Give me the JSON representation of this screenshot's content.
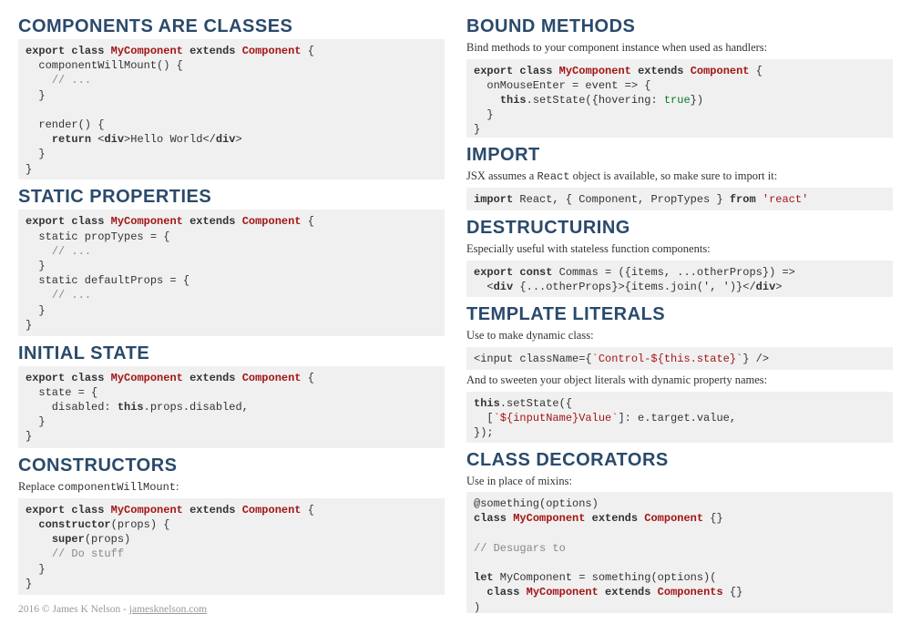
{
  "left": {
    "s1": {
      "title": "Components are Classes",
      "code_tokens": [
        {
          "t": "kw",
          "v": "export"
        },
        {
          "t": "sp",
          "v": " "
        },
        {
          "t": "kw",
          "v": "class"
        },
        {
          "t": "sp",
          "v": " "
        },
        {
          "t": "cls",
          "v": "MyComponent"
        },
        {
          "t": "sp",
          "v": " "
        },
        {
          "t": "kw",
          "v": "extends"
        },
        {
          "t": "sp",
          "v": " "
        },
        {
          "t": "ext",
          "v": "Component"
        },
        {
          "t": "txt",
          "v": " {"
        },
        {
          "t": "nl"
        },
        {
          "t": "txt",
          "v": "  componentWillMount() {"
        },
        {
          "t": "nl"
        },
        {
          "t": "txt",
          "v": "    "
        },
        {
          "t": "com",
          "v": "// ..."
        },
        {
          "t": "nl"
        },
        {
          "t": "txt",
          "v": "  }"
        },
        {
          "t": "nl"
        },
        {
          "t": "nl"
        },
        {
          "t": "txt",
          "v": "  render() {"
        },
        {
          "t": "nl"
        },
        {
          "t": "txt",
          "v": "    "
        },
        {
          "t": "kw",
          "v": "return"
        },
        {
          "t": "txt",
          "v": " <"
        },
        {
          "t": "kw",
          "v": "div"
        },
        {
          "t": "txt",
          "v": ">Hello World</"
        },
        {
          "t": "kw",
          "v": "div"
        },
        {
          "t": "txt",
          "v": ">"
        },
        {
          "t": "nl"
        },
        {
          "t": "txt",
          "v": "  }"
        },
        {
          "t": "nl"
        },
        {
          "t": "txt",
          "v": "}"
        }
      ]
    },
    "s2": {
      "title": "Static Properties",
      "code_tokens": [
        {
          "t": "kw",
          "v": "export"
        },
        {
          "t": "sp",
          "v": " "
        },
        {
          "t": "kw",
          "v": "class"
        },
        {
          "t": "sp",
          "v": " "
        },
        {
          "t": "cls",
          "v": "MyComponent"
        },
        {
          "t": "sp",
          "v": " "
        },
        {
          "t": "kw",
          "v": "extends"
        },
        {
          "t": "sp",
          "v": " "
        },
        {
          "t": "ext",
          "v": "Component"
        },
        {
          "t": "txt",
          "v": " {"
        },
        {
          "t": "nl"
        },
        {
          "t": "txt",
          "v": "  static propTypes = {"
        },
        {
          "t": "nl"
        },
        {
          "t": "txt",
          "v": "    "
        },
        {
          "t": "com",
          "v": "// ..."
        },
        {
          "t": "nl"
        },
        {
          "t": "txt",
          "v": "  }"
        },
        {
          "t": "nl"
        },
        {
          "t": "txt",
          "v": "  static defaultProps = {"
        },
        {
          "t": "nl"
        },
        {
          "t": "txt",
          "v": "    "
        },
        {
          "t": "com",
          "v": "// ..."
        },
        {
          "t": "nl"
        },
        {
          "t": "txt",
          "v": "  }"
        },
        {
          "t": "nl"
        },
        {
          "t": "txt",
          "v": "}"
        }
      ]
    },
    "s3": {
      "title": "Initial State",
      "code_tokens": [
        {
          "t": "kw",
          "v": "export"
        },
        {
          "t": "sp",
          "v": " "
        },
        {
          "t": "kw",
          "v": "class"
        },
        {
          "t": "sp",
          "v": " "
        },
        {
          "t": "cls",
          "v": "MyComponent"
        },
        {
          "t": "sp",
          "v": " "
        },
        {
          "t": "kw",
          "v": "extends"
        },
        {
          "t": "sp",
          "v": " "
        },
        {
          "t": "ext",
          "v": "Component"
        },
        {
          "t": "txt",
          "v": " {"
        },
        {
          "t": "nl"
        },
        {
          "t": "txt",
          "v": "  state = {"
        },
        {
          "t": "nl"
        },
        {
          "t": "txt",
          "v": "    disabled: "
        },
        {
          "t": "kw",
          "v": "this"
        },
        {
          "t": "txt",
          "v": ".props.disabled,"
        },
        {
          "t": "nl"
        },
        {
          "t": "txt",
          "v": "  }"
        },
        {
          "t": "nl"
        },
        {
          "t": "txt",
          "v": "}"
        }
      ]
    },
    "s4": {
      "title": "Constructors",
      "desc_pre": "Replace ",
      "desc_code": "componentWillMount",
      "desc_post": ":",
      "code_tokens": [
        {
          "t": "kw",
          "v": "export"
        },
        {
          "t": "sp",
          "v": " "
        },
        {
          "t": "kw",
          "v": "class"
        },
        {
          "t": "sp",
          "v": " "
        },
        {
          "t": "cls",
          "v": "MyComponent"
        },
        {
          "t": "sp",
          "v": " "
        },
        {
          "t": "kw",
          "v": "extends"
        },
        {
          "t": "sp",
          "v": " "
        },
        {
          "t": "ext",
          "v": "Component"
        },
        {
          "t": "txt",
          "v": " {"
        },
        {
          "t": "nl"
        },
        {
          "t": "txt",
          "v": "  "
        },
        {
          "t": "kw",
          "v": "constructor"
        },
        {
          "t": "txt",
          "v": "(props) {"
        },
        {
          "t": "nl"
        },
        {
          "t": "txt",
          "v": "    "
        },
        {
          "t": "kw",
          "v": "super"
        },
        {
          "t": "txt",
          "v": "(props)"
        },
        {
          "t": "nl"
        },
        {
          "t": "txt",
          "v": "    "
        },
        {
          "t": "com",
          "v": "// Do stuff"
        },
        {
          "t": "nl"
        },
        {
          "t": "txt",
          "v": "  }"
        },
        {
          "t": "nl"
        },
        {
          "t": "txt",
          "v": "}"
        }
      ]
    },
    "footer_pre": "2016 © James K Nelson - ",
    "footer_link": "jamesknelson.com"
  },
  "right": {
    "s1": {
      "title": "Bound Methods",
      "desc": "Bind methods to your component instance when used as handlers:",
      "code_tokens": [
        {
          "t": "kw",
          "v": "export"
        },
        {
          "t": "sp",
          "v": " "
        },
        {
          "t": "kw",
          "v": "class"
        },
        {
          "t": "sp",
          "v": " "
        },
        {
          "t": "cls",
          "v": "MyComponent"
        },
        {
          "t": "sp",
          "v": " "
        },
        {
          "t": "kw",
          "v": "extends"
        },
        {
          "t": "sp",
          "v": " "
        },
        {
          "t": "ext",
          "v": "Component"
        },
        {
          "t": "txt",
          "v": " {"
        },
        {
          "t": "nl"
        },
        {
          "t": "txt",
          "v": "  onMouseEnter = event => {"
        },
        {
          "t": "nl"
        },
        {
          "t": "txt",
          "v": "    "
        },
        {
          "t": "kw",
          "v": "this"
        },
        {
          "t": "txt",
          "v": ".setState({hovering: "
        },
        {
          "t": "val",
          "v": "true"
        },
        {
          "t": "txt",
          "v": "})"
        },
        {
          "t": "nl"
        },
        {
          "t": "txt",
          "v": "  }"
        },
        {
          "t": "nl"
        },
        {
          "t": "txt",
          "v": "}"
        }
      ]
    },
    "s2": {
      "title": "Import",
      "desc_pre": "JSX assumes a ",
      "desc_code": "React",
      "desc_post": " object is available, so make sure to import it:",
      "code_tokens": [
        {
          "t": "kw",
          "v": "import"
        },
        {
          "t": "txt",
          "v": " React, { Component, PropTypes } "
        },
        {
          "t": "kw",
          "v": "from"
        },
        {
          "t": "txt",
          "v": " "
        },
        {
          "t": "str",
          "v": "'react'"
        }
      ]
    },
    "s3": {
      "title": "Destructuring",
      "desc": "Especially useful with stateless function components:",
      "code_tokens": [
        {
          "t": "kw",
          "v": "export"
        },
        {
          "t": "sp",
          "v": " "
        },
        {
          "t": "kw",
          "v": "const"
        },
        {
          "t": "txt",
          "v": " Commas = ({items, ...otherProps}) =>"
        },
        {
          "t": "nl"
        },
        {
          "t": "txt",
          "v": "  <"
        },
        {
          "t": "kw",
          "v": "div"
        },
        {
          "t": "txt",
          "v": " {...otherProps}>{items.join(', ')}</"
        },
        {
          "t": "kw",
          "v": "div"
        },
        {
          "t": "txt",
          "v": ">"
        }
      ]
    },
    "s4": {
      "title": "Template Literals",
      "desc1": "Use to make dynamic class:",
      "code1_tokens": [
        {
          "t": "txt",
          "v": "<input className={"
        },
        {
          "t": "str",
          "v": "`Control-${this.state}`"
        },
        {
          "t": "txt",
          "v": "} />"
        }
      ],
      "desc2": "And to sweeten your object literals with dynamic property names:",
      "code2_tokens": [
        {
          "t": "kw",
          "v": "this"
        },
        {
          "t": "txt",
          "v": ".setState({"
        },
        {
          "t": "nl"
        },
        {
          "t": "txt",
          "v": "  ["
        },
        {
          "t": "str",
          "v": "`${inputName}Value`"
        },
        {
          "t": "txt",
          "v": "]: e.target.value,"
        },
        {
          "t": "nl"
        },
        {
          "t": "txt",
          "v": "});"
        }
      ]
    },
    "s5": {
      "title": "Class Decorators",
      "desc": "Use in place of mixins:",
      "code_tokens": [
        {
          "t": "txt",
          "v": "@something(options)"
        },
        {
          "t": "nl"
        },
        {
          "t": "kw",
          "v": "class"
        },
        {
          "t": "sp",
          "v": " "
        },
        {
          "t": "cls",
          "v": "MyComponent"
        },
        {
          "t": "sp",
          "v": " "
        },
        {
          "t": "kw",
          "v": "extends"
        },
        {
          "t": "sp",
          "v": " "
        },
        {
          "t": "ext",
          "v": "Component"
        },
        {
          "t": "txt",
          "v": " {}"
        },
        {
          "t": "nl"
        },
        {
          "t": "nl"
        },
        {
          "t": "com",
          "v": "// Desugars to"
        },
        {
          "t": "nl"
        },
        {
          "t": "nl"
        },
        {
          "t": "kw",
          "v": "let"
        },
        {
          "t": "txt",
          "v": " MyComponent = something(options)("
        },
        {
          "t": "nl"
        },
        {
          "t": "txt",
          "v": "  "
        },
        {
          "t": "kw",
          "v": "class"
        },
        {
          "t": "sp",
          "v": " "
        },
        {
          "t": "cls",
          "v": "MyComponent"
        },
        {
          "t": "sp",
          "v": " "
        },
        {
          "t": "kw",
          "v": "extends"
        },
        {
          "t": "sp",
          "v": " "
        },
        {
          "t": "ext",
          "v": "Components"
        },
        {
          "t": "txt",
          "v": " {}"
        },
        {
          "t": "nl"
        },
        {
          "t": "txt",
          "v": ")"
        }
      ]
    }
  }
}
